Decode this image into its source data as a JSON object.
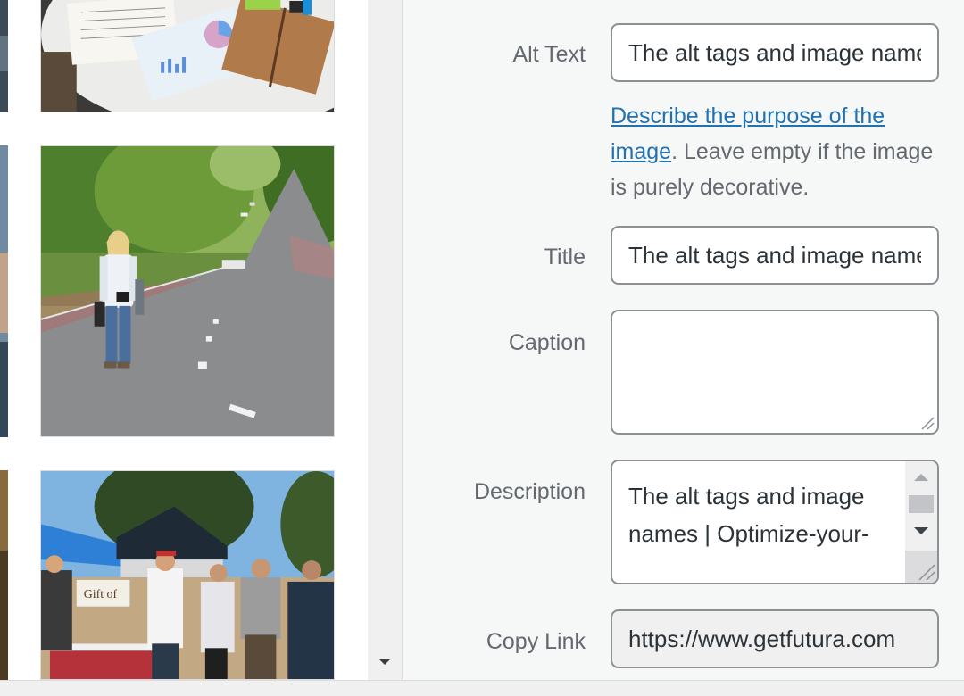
{
  "media_grid": {
    "thumbnails": [
      {
        "name": "desk-documents-photo"
      },
      {
        "name": "woman-on-road-photo"
      },
      {
        "name": "outdoor-market-photo"
      }
    ],
    "market_tent_sign": "Gift of"
  },
  "attachment_details": {
    "alt_text": {
      "label": "Alt Text",
      "value": "The alt tags and image names | Optimize-your-images"
    },
    "alt_help": {
      "link_text": "Describe the purpose of the image",
      "rest": ". Leave empty if the image is purely decorative."
    },
    "title": {
      "label": "Title",
      "value": "The alt tags and image names"
    },
    "caption": {
      "label": "Caption",
      "value": ""
    },
    "description": {
      "label": "Description",
      "value": "The alt tags and image names | Optimize-your-"
    },
    "copy_link": {
      "label": "Copy Link",
      "value": "https://www.getfutura.com"
    }
  }
}
